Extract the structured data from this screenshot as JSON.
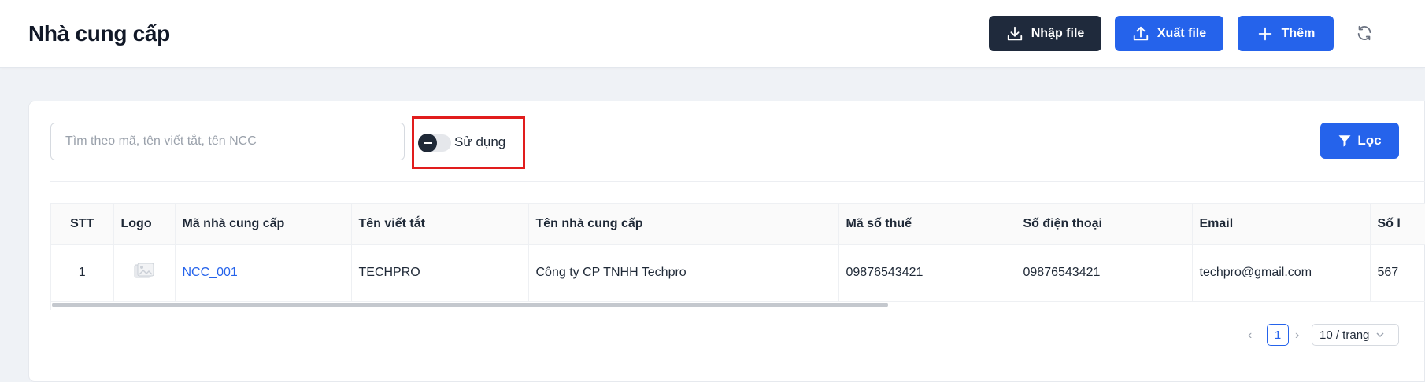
{
  "header": {
    "title": "Nhà cung cấp",
    "import_label": "Nhập file",
    "export_label": "Xuất file",
    "add_label": "Thêm"
  },
  "toolbar": {
    "search_placeholder": "Tìm theo mã, tên viết tắt, tên NCC",
    "search_value": "",
    "toggle_label": "Sử dụng",
    "toggle_on": false,
    "filter_label": "Lọc"
  },
  "table": {
    "columns": [
      "STT",
      "Logo",
      "Mã nhà cung cấp",
      "Tên viết tắt",
      "Tên nhà cung cấp",
      "Mã số thuế",
      "Số điện thoại",
      "Email",
      "Số l"
    ],
    "rows": [
      {
        "stt": "1",
        "code": "NCC_001",
        "short_name": "TECHPRO",
        "name": "Công ty CP TNHH Techpro",
        "tax_code": "09876543421",
        "phone": "09876543421",
        "email": "techpro@gmail.com",
        "extra": "567"
      }
    ]
  },
  "pagination": {
    "current_page": "1",
    "page_size_label": "10 / trang"
  },
  "colors": {
    "primary": "#2563eb",
    "dark_button": "#1f2a3c",
    "highlight": "#e11d1d",
    "background": "#eff2f6"
  },
  "icons": {
    "import": "download-icon",
    "export": "upload-icon",
    "add": "plus-icon",
    "refresh": "refresh-icon",
    "filter": "filter-icon",
    "logo_placeholder": "image-placeholder-icon"
  }
}
